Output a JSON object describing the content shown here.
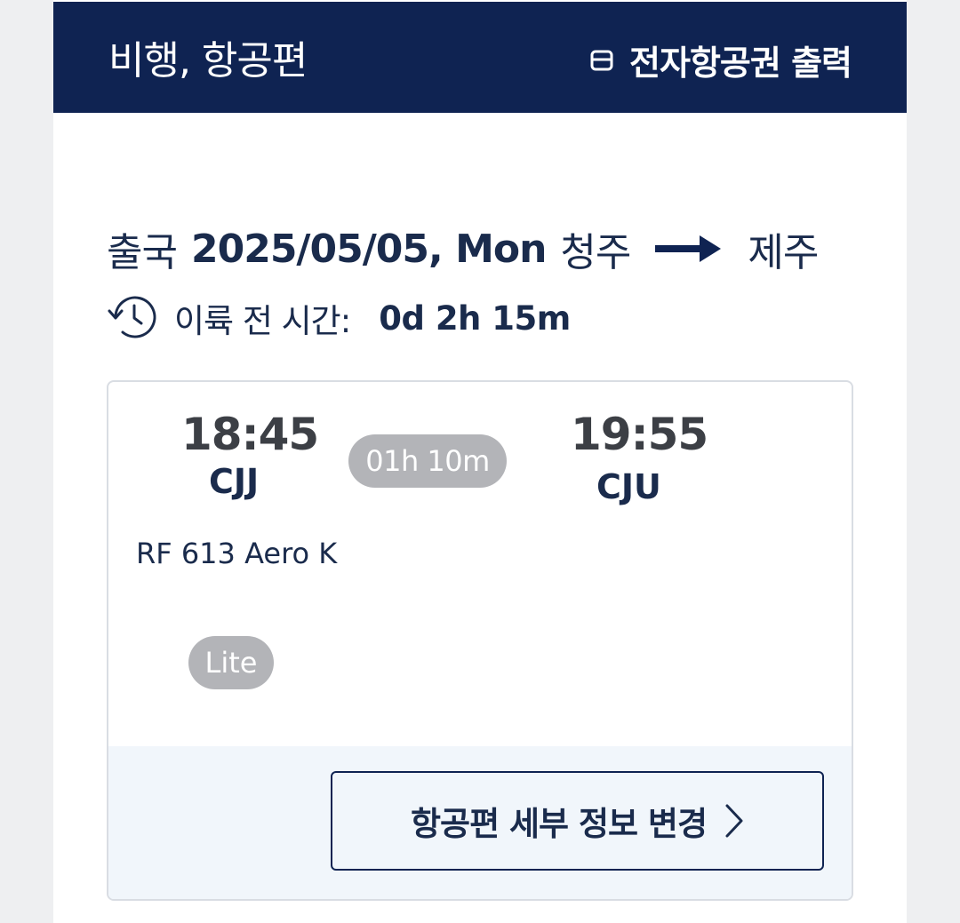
{
  "header": {
    "title": "비행, 항공편",
    "eticket_label": "전자항공권 출력"
  },
  "route": {
    "direction": "출국",
    "date": "2025/05/05, Mon",
    "origin": "청주",
    "destination": "제주"
  },
  "countdown": {
    "label": "이륙 전 시간:",
    "value": "0d 2h 15m"
  },
  "flight": {
    "departure_time": "18:45",
    "departure_code": "CJJ",
    "duration": "01h 10m",
    "arrival_time": "19:55",
    "arrival_code": "CJU",
    "info": "RF 613 Aero K",
    "fare": "Lite"
  },
  "actions": {
    "change_label": "항공편 세부 정보 변경"
  },
  "colors": {
    "header_bg": "#0f2352",
    "text_primary": "#1a2b4c",
    "pill_bg": "#b3b4b8",
    "card_footer_bg": "#f1f6fb"
  }
}
